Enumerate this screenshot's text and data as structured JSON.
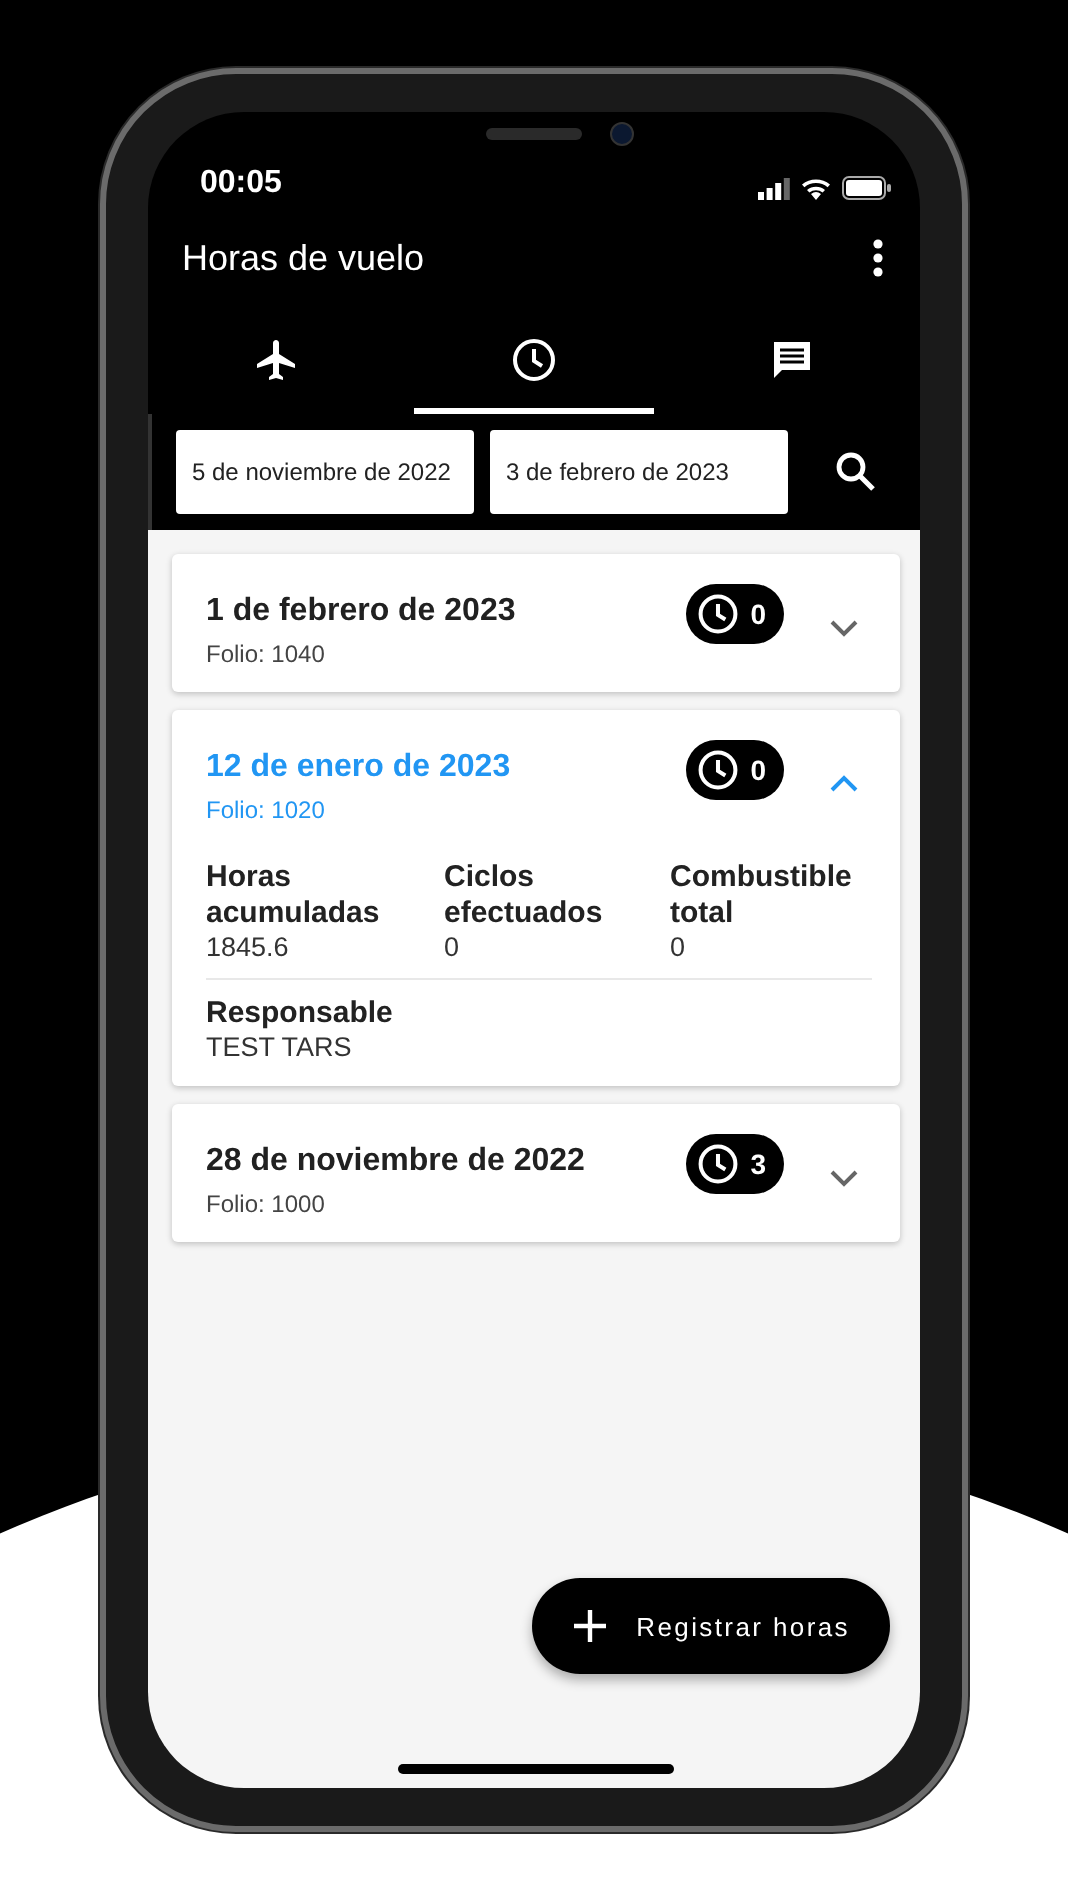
{
  "status_bar": {
    "time": "00:05"
  },
  "app_bar": {
    "title": "Horas de vuelo"
  },
  "tabs": [
    {
      "kind": "plane",
      "selected": false
    },
    {
      "kind": "clock",
      "selected": true
    },
    {
      "kind": "chat",
      "selected": false
    }
  ],
  "filters": {
    "from": "5 de noviembre de 2022",
    "to": "3 de febrero de 2023"
  },
  "entries": [
    {
      "date": "1 de febrero de 2023",
      "folio": "Folio: 1040",
      "count": "0",
      "expanded": false
    },
    {
      "date": "12 de enero de 2023",
      "folio": "Folio: 1020",
      "count": "0",
      "expanded": true,
      "details": [
        {
          "label": "Horas acumuladas",
          "value": "1845.6"
        },
        {
          "label": "Ciclos efectuados",
          "value": "0"
        },
        {
          "label": "Combustible total",
          "value": "0"
        }
      ],
      "responsible_label": "Responsable",
      "responsible": "TEST TARS"
    },
    {
      "date": "28 de noviembre de 2022",
      "folio": "Folio: 1000",
      "count": "3",
      "expanded": false
    }
  ],
  "fab": {
    "label": "Registrar horas"
  }
}
